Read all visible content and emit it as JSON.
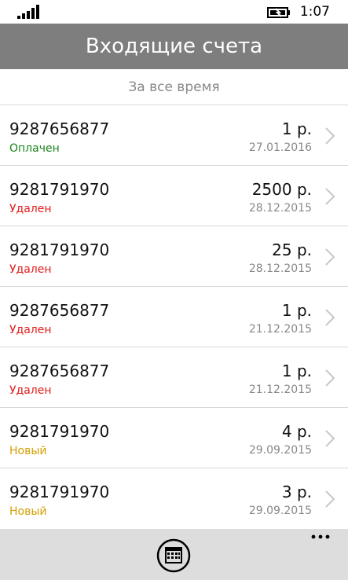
{
  "status_bar": {
    "time": "1:07",
    "icons": [
      "signal-icon",
      "battery-charging-icon"
    ]
  },
  "header": {
    "title": "Входящие счета"
  },
  "filter": {
    "label": "За все время"
  },
  "colors": {
    "paid": "#188418",
    "deleted": "#e21a1a",
    "new": "#d4a000",
    "header_bg": "#7e7e7e",
    "app_bar_bg": "#dddddd"
  },
  "invoices": [
    {
      "phone": "9287656877",
      "status": "Оплачен",
      "status_type": "paid",
      "amount": "1 р.",
      "date": "27.01.2016"
    },
    {
      "phone": "9281791970",
      "status": "Удален",
      "status_type": "deleted",
      "amount": "2500 р.",
      "date": "28.12.2015"
    },
    {
      "phone": "9281791970",
      "status": "Удален",
      "status_type": "deleted",
      "amount": "25 р.",
      "date": "28.12.2015"
    },
    {
      "phone": "9287656877",
      "status": "Удален",
      "status_type": "deleted",
      "amount": "1 р.",
      "date": "21.12.2015"
    },
    {
      "phone": "9287656877",
      "status": "Удален",
      "status_type": "deleted",
      "amount": "1 р.",
      "date": "21.12.2015"
    },
    {
      "phone": "9281791970",
      "status": "Новый",
      "status_type": "new",
      "amount": "4 р.",
      "date": "29.09.2015"
    },
    {
      "phone": "9281791970",
      "status": "Новый",
      "status_type": "new",
      "amount": "3 р.",
      "date": "29.09.2015"
    }
  ],
  "app_bar": {
    "primary_icon": "calendar-icon",
    "more_icon": "more-dots-icon"
  }
}
